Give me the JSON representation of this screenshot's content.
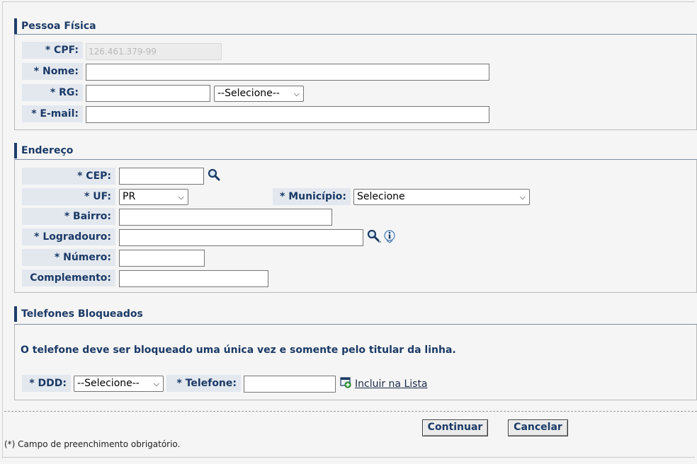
{
  "pessoa_fisica": {
    "title": "Pessoa Física",
    "cpf_label": "* CPF:",
    "cpf_value": "126.461.379-99",
    "nome_label": "* Nome:",
    "rg_label": "* RG:",
    "rg_select": "--Selecione--",
    "email_label": "* E-mail:"
  },
  "endereco": {
    "title": "Endereço",
    "cep_label": "* CEP:",
    "uf_label": "* UF:",
    "uf_value": "PR",
    "municipio_label": "* Município:",
    "municipio_value": "Selecione",
    "bairro_label": "* Bairro:",
    "logradouro_label": "* Logradouro:",
    "numero_label": "* Número:",
    "complemento_label": "Complemento:"
  },
  "telefones": {
    "title": "Telefones Bloqueados",
    "info": "O telefone deve ser bloqueado uma única vez e somente pelo titular da linha.",
    "ddd_label": "* DDD:",
    "ddd_select": "--Selecione--",
    "telefone_label": "* Telefone:",
    "incluir_link": "Incluir na Lista"
  },
  "actions": {
    "continuar": "Continuar",
    "cancelar": "Cancelar"
  },
  "footer_note": "(*) Campo de preenchimento obrigatório."
}
